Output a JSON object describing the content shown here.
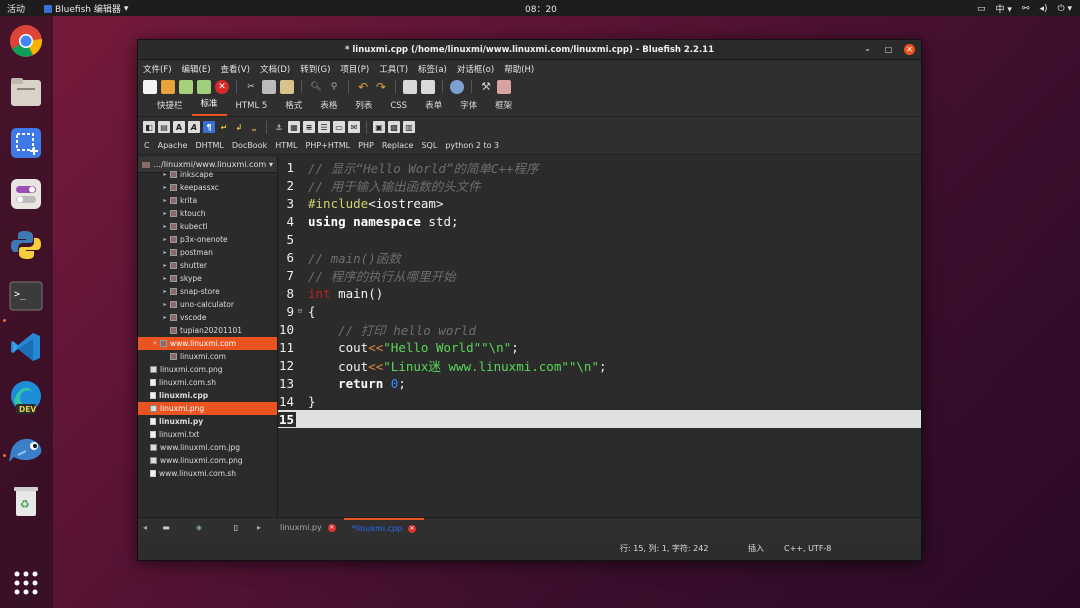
{
  "topbar": {
    "activities": "活动",
    "app_name": "Bluefish 编辑器",
    "clock": "08：20",
    "input_method": "中"
  },
  "window": {
    "title": "* linuxmi.cpp (/home/linuxmi/www.linuxmi.com/linuxmi.cpp) - Bluefish 2.2.11"
  },
  "menu": [
    "文件(F)",
    "编辑(E)",
    "查看(V)",
    "文档(D)",
    "转到(G)",
    "项目(P)",
    "工具(T)",
    "标签(a)",
    "对话框(o)",
    "帮助(H)"
  ],
  "tabs1": [
    "快捷栏",
    "标准",
    "HTML 5",
    "格式",
    "表格",
    "列表",
    "CSS",
    "表单",
    "字体",
    "框架"
  ],
  "tabs1_active": 1,
  "tabs2": [
    "C",
    "Apache",
    "DHTML",
    "DocBook",
    "HTML",
    "PHP+HTML",
    "PHP",
    "Replace",
    "SQL",
    "python 2 to 3"
  ],
  "sidebar": {
    "path": "…/linuxmi/www.linuxmi.com",
    "items": [
      {
        "label": "inkscape",
        "type": "folder",
        "indent": 2,
        "arrow": "▸"
      },
      {
        "label": "keepassxc",
        "type": "folder",
        "indent": 2,
        "arrow": "▸"
      },
      {
        "label": "krita",
        "type": "folder",
        "indent": 2,
        "arrow": "▸"
      },
      {
        "label": "ktouch",
        "type": "folder",
        "indent": 2,
        "arrow": "▸"
      },
      {
        "label": "kubectl",
        "type": "folder",
        "indent": 2,
        "arrow": "▸"
      },
      {
        "label": "p3x-onenote",
        "type": "folder",
        "indent": 2,
        "arrow": "▸"
      },
      {
        "label": "postman",
        "type": "folder",
        "indent": 2,
        "arrow": "▸"
      },
      {
        "label": "shutter",
        "type": "folder",
        "indent": 2,
        "arrow": "▸"
      },
      {
        "label": "skype",
        "type": "folder",
        "indent": 2,
        "arrow": "▸"
      },
      {
        "label": "snap-store",
        "type": "folder",
        "indent": 2,
        "arrow": "▸"
      },
      {
        "label": "uno-calculator",
        "type": "folder",
        "indent": 2,
        "arrow": "▸"
      },
      {
        "label": "vscode",
        "type": "folder",
        "indent": 2,
        "arrow": "▸"
      },
      {
        "label": "tupian20201101",
        "type": "folder",
        "indent": 2,
        "arrow": ""
      },
      {
        "label": "www.linuxmi.com",
        "type": "folder",
        "indent": 1,
        "arrow": "▾",
        "selected": true
      },
      {
        "label": "linuxmi.com",
        "type": "folder",
        "indent": 2,
        "arrow": ""
      },
      {
        "label": "linuxmi.com.png",
        "type": "img",
        "indent": 0,
        "arrow": ""
      },
      {
        "label": "linuxmi.com.sh",
        "type": "file",
        "indent": 0,
        "arrow": ""
      },
      {
        "label": "linuxmi.cpp",
        "type": "file",
        "indent": 0,
        "arrow": "",
        "bold": true
      },
      {
        "label": "linuxmi.png",
        "type": "img",
        "indent": 0,
        "arrow": "",
        "selected": true
      },
      {
        "label": "linuxmi.py",
        "type": "file",
        "indent": 0,
        "arrow": "",
        "bold": true
      },
      {
        "label": "linuxmi.txt",
        "type": "file",
        "indent": 0,
        "arrow": ""
      },
      {
        "label": "www.linuxmi.com.jpg",
        "type": "img",
        "indent": 0,
        "arrow": ""
      },
      {
        "label": "www.linuxmi.com.png",
        "type": "img",
        "indent": 0,
        "arrow": ""
      },
      {
        "label": "www.linuxmi.com.sh",
        "type": "file",
        "indent": 0,
        "arrow": ""
      }
    ]
  },
  "editor": {
    "lines": [
      {
        "n": "1",
        "parts": [
          [
            "c-comment",
            "// 显示“Hello World”的简单C++程序"
          ]
        ]
      },
      {
        "n": "2",
        "parts": [
          [
            "c-comment",
            "// 用于输入输出函数的头文件"
          ]
        ]
      },
      {
        "n": "3",
        "parts": [
          [
            "c-pre",
            "#include"
          ],
          [
            "c-plain",
            "<iostream>"
          ]
        ]
      },
      {
        "n": "4",
        "parts": [
          [
            "c-kw",
            "using namespace"
          ],
          [
            "c-plain",
            " std;"
          ]
        ]
      },
      {
        "n": "5",
        "parts": []
      },
      {
        "n": "6",
        "parts": [
          [
            "c-comment",
            "// main()函数"
          ]
        ]
      },
      {
        "n": "7",
        "parts": [
          [
            "c-comment",
            "// 程序的执行从哪里开始"
          ]
        ]
      },
      {
        "n": "8",
        "parts": [
          [
            "c-type",
            "int"
          ],
          [
            "c-plain",
            " main()"
          ]
        ]
      },
      {
        "n": "9",
        "fold": "⊟",
        "parts": [
          [
            "c-plain",
            "{"
          ]
        ]
      },
      {
        "n": "10",
        "parts": [
          [
            "c-comment",
            "    // 打印 hello world"
          ]
        ]
      },
      {
        "n": "11",
        "parts": [
          [
            "c-plain",
            "    cout"
          ],
          [
            "c-op",
            "<<"
          ],
          [
            "c-str",
            "\"Hello World\"\"\\n\""
          ],
          [
            "c-plain",
            ";"
          ]
        ]
      },
      {
        "n": "12",
        "parts": [
          [
            "c-plain",
            "    cout"
          ],
          [
            "c-op",
            "<<"
          ],
          [
            "c-str",
            "\"Linux迷 www.linuxmi.com\"\"\\n\""
          ],
          [
            "c-plain",
            ";"
          ]
        ]
      },
      {
        "n": "13",
        "parts": [
          [
            "c-kw",
            "    return "
          ],
          [
            "c-num",
            "0"
          ],
          [
            "c-plain",
            ";"
          ]
        ]
      },
      {
        "n": "14",
        "parts": [
          [
            "c-plain",
            "}"
          ]
        ]
      },
      {
        "n": "15",
        "current": true,
        "parts": []
      }
    ]
  },
  "bottom_tabs": [
    {
      "label": "linuxmi.py",
      "active": false
    },
    {
      "label": "*linuxmi.cpp",
      "active": true
    }
  ],
  "status": {
    "position": "行: 15, 列: 1, 字符: 242",
    "mode": "插入",
    "encoding": "C++, UTF-8"
  },
  "colors": {
    "accent": "#e95420",
    "close_icon": "#e0302c"
  }
}
